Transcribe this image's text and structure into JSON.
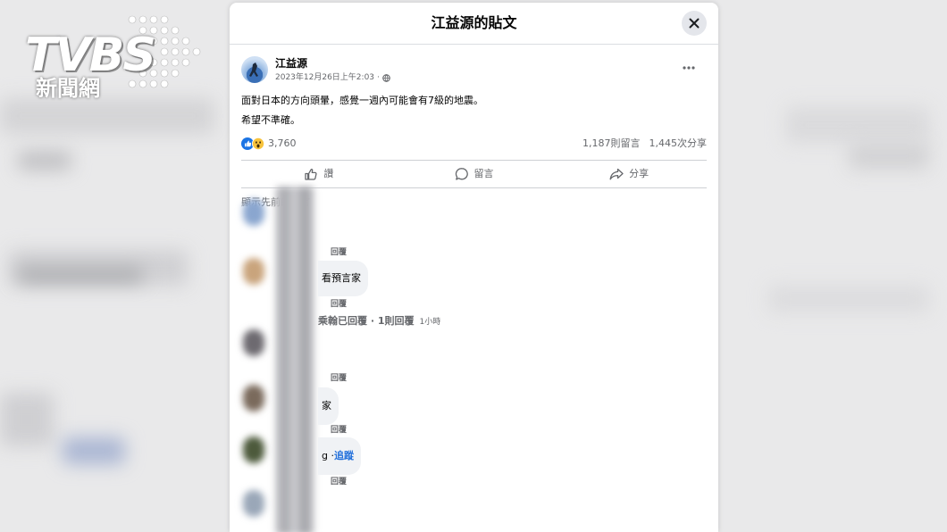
{
  "watermark": {
    "brand": "TVBS",
    "sub": "新聞網"
  },
  "dialog": {
    "title": "江益源的貼文"
  },
  "post": {
    "author": "江益源",
    "timestamp": "2023年12月26日上午2:03",
    "privacy_icon": "globe-icon",
    "lines": [
      "面對日本的方向頭暈，感覺一週內可能會有7級的地震。",
      "希望不準確。"
    ],
    "reaction_icons": [
      "like-icon",
      "wow-icon"
    ],
    "reaction_count": "3,760",
    "comments_count": "1,187則留言",
    "shares_count": "1,445次分享"
  },
  "actions": {
    "like": "讚",
    "comment": "留言",
    "share": "分享"
  },
  "comments": {
    "prev_label": "顯示先前的留言",
    "reply_label": "回覆",
    "bubble_1": "看預言家",
    "thread": "乘翰已回覆 · 1則回覆",
    "thread_time": "1小時",
    "bubble_2": "家",
    "bubble_3_text": "g · ",
    "bubble_3_link": "追蹤"
  },
  "colors": {
    "accent": "#216fdb",
    "text": "#050505",
    "muted": "#65676b"
  }
}
